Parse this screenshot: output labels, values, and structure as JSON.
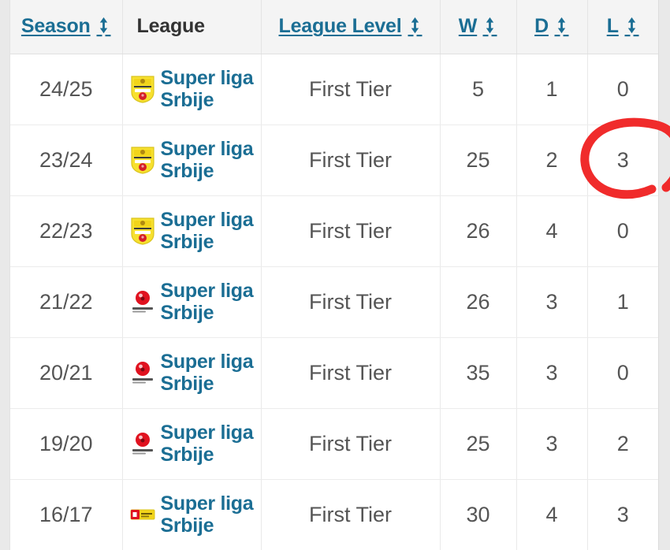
{
  "table": {
    "columns": [
      {
        "key": "season",
        "label": "Season",
        "sortable": true,
        "icon": "sort-updown-icon",
        "align": "center"
      },
      {
        "key": "league",
        "label": "League",
        "sortable": false,
        "icon": null,
        "align": "left"
      },
      {
        "key": "level",
        "label": "League Level",
        "sortable": true,
        "icon": "sort-updown-icon",
        "align": "center"
      },
      {
        "key": "w",
        "label": "W",
        "sortable": true,
        "icon": "sort-updown-icon",
        "align": "center"
      },
      {
        "key": "d",
        "label": "D",
        "sortable": true,
        "icon": "sort-updown-icon",
        "align": "center"
      },
      {
        "key": "l",
        "label": "L",
        "sortable": true,
        "icon": "sort-updown-icon",
        "align": "center"
      }
    ],
    "rows": [
      {
        "season": "24/25",
        "league": "Super liga Srbije",
        "logo": "yellow-shield-badge-icon",
        "level": "First Tier",
        "w": "5",
        "d": "1",
        "l": "0"
      },
      {
        "season": "23/24",
        "league": "Super liga Srbije",
        "logo": "yellow-shield-badge-icon",
        "level": "First Tier",
        "w": "25",
        "d": "2",
        "l": "3"
      },
      {
        "season": "22/23",
        "league": "Super liga Srbije",
        "logo": "yellow-shield-badge-icon",
        "level": "First Tier",
        "w": "26",
        "d": "4",
        "l": "0"
      },
      {
        "season": "21/22",
        "league": "Super liga Srbije",
        "logo": "red-ball-badge-icon",
        "level": "First Tier",
        "w": "26",
        "d": "3",
        "l": "1"
      },
      {
        "season": "20/21",
        "league": "Super liga Srbije",
        "logo": "red-ball-badge-icon",
        "level": "First Tier",
        "w": "35",
        "d": "3",
        "l": "0"
      },
      {
        "season": "19/20",
        "league": "Super liga Srbije",
        "logo": "red-ball-badge-icon",
        "level": "First Tier",
        "w": "25",
        "d": "3",
        "l": "2"
      },
      {
        "season": "16/17",
        "league": "Super liga Srbije",
        "logo": "red-yellow-bar-badge-icon",
        "level": "First Tier",
        "w": "30",
        "d": "4",
        "l": "3"
      }
    ]
  },
  "annotation": {
    "type": "hand-drawn-circle",
    "target_cell": "row 23/24, column L",
    "target_value": "3",
    "color": "#f02b2b"
  },
  "colors": {
    "link": "#1b6e94",
    "text": "#555555",
    "header_bg": "#f4f4f4",
    "header_text": "#333333",
    "page_bg": "#e9e9e9",
    "annotation": "#f02b2b"
  }
}
